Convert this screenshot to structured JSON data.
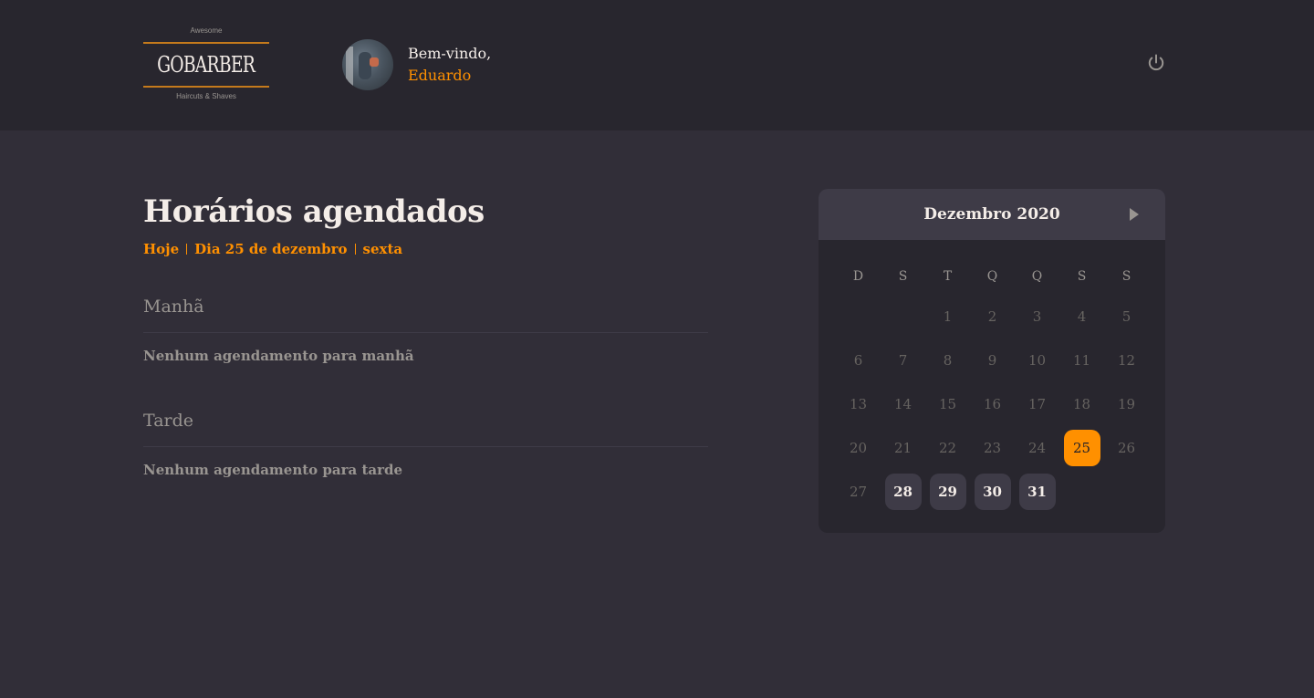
{
  "header": {
    "logo": {
      "top_text": "Awesome",
      "brand": "GOBARBER",
      "bottom_text": "Haircuts & Shaves"
    },
    "user": {
      "welcome": "Bem-vindo,",
      "name": "Eduardo"
    },
    "power_icon": "power-icon"
  },
  "main": {
    "title": "Horários agendados",
    "date_parts": [
      "Hoje",
      "Dia 25 de dezembro",
      "sexta"
    ],
    "sections": [
      {
        "title": "Manhã",
        "empty_text": "Nenhum agendamento para manhã"
      },
      {
        "title": "Tarde",
        "empty_text": "Nenhum agendamento para tarde"
      }
    ]
  },
  "calendar": {
    "month_label": "Dezembro 2020",
    "next_icon": "triangle-right-icon",
    "weekdays": [
      "D",
      "S",
      "T",
      "Q",
      "Q",
      "S",
      "S"
    ],
    "weeks": [
      [
        "",
        "",
        "1",
        "2",
        "3",
        "4",
        "5"
      ],
      [
        "6",
        "7",
        "8",
        "9",
        "10",
        "11",
        "12"
      ],
      [
        "13",
        "14",
        "15",
        "16",
        "17",
        "18",
        "19"
      ],
      [
        "20",
        "21",
        "22",
        "23",
        "24",
        "25",
        "26"
      ],
      [
        "27",
        "28",
        "29",
        "30",
        "31",
        "",
        ""
      ]
    ],
    "selected_day": "25",
    "available_days": [
      "28",
      "29",
      "30",
      "31"
    ],
    "colors": {
      "accent": "#ff9000",
      "available_bg": "#3e3b47"
    }
  }
}
